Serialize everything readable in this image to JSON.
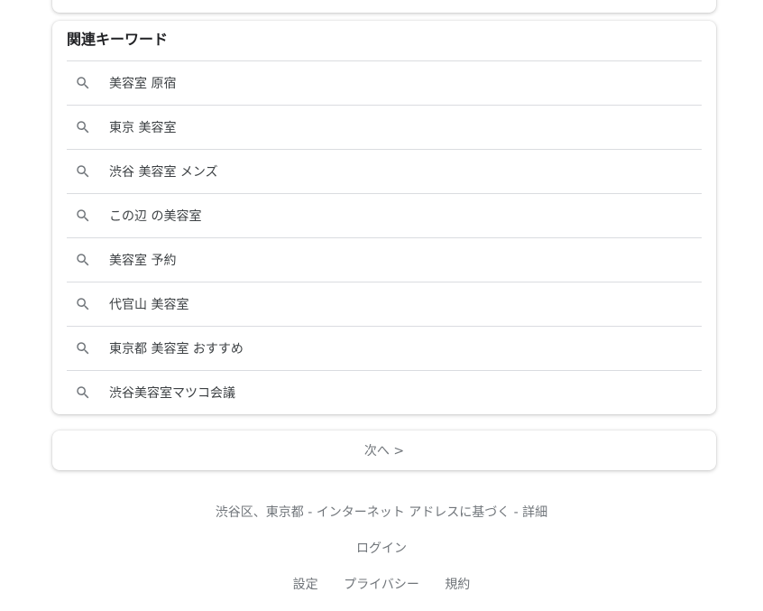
{
  "related": {
    "title": "関連キーワード",
    "items": [
      {
        "label": "美容室 原宿"
      },
      {
        "label": "東京 美容室"
      },
      {
        "label": "渋谷 美容室 メンズ"
      },
      {
        "label": "この辺 の美容室"
      },
      {
        "label": "美容室 予約"
      },
      {
        "label": "代官山 美容室"
      },
      {
        "label": "東京都 美容室 おすすめ"
      },
      {
        "label": "渋谷美容室マツコ会議"
      }
    ]
  },
  "pagination": {
    "next_label": "次へ >"
  },
  "footer": {
    "location_text": "渋谷区、東京都 - インターネット アドレスに基づく - ",
    "details_link": "詳細",
    "login": "ログイン",
    "links": [
      "設定",
      "プライバシー",
      "規約"
    ]
  },
  "colors": {
    "icon": "#70757a",
    "divider": "#dadce0"
  }
}
